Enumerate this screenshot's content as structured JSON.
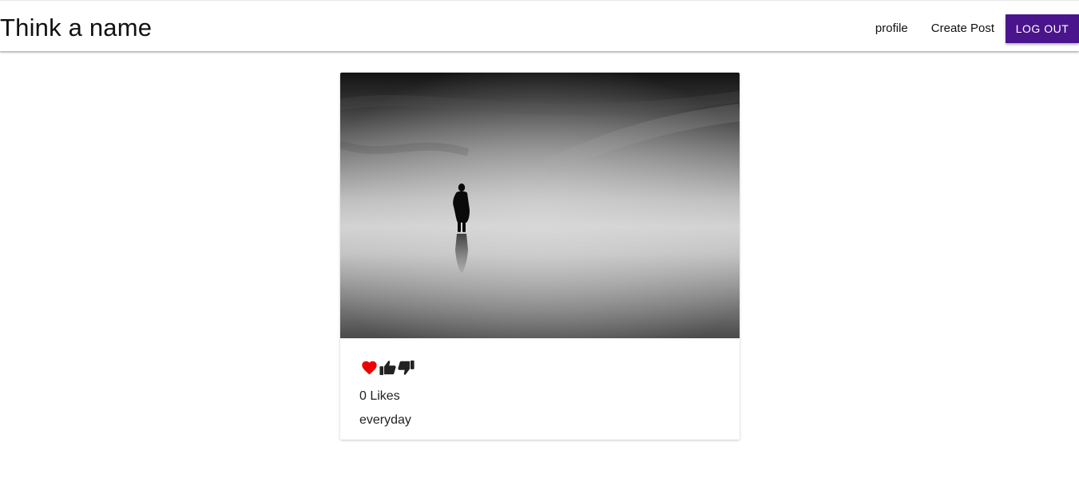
{
  "header": {
    "brand": "Think a name",
    "nav": {
      "profile": "profile",
      "create_post": "Create Post",
      "logout": "LOG OUT"
    },
    "accent_color": "#4a148c"
  },
  "post": {
    "image_icon": "photo-fog-silhouette",
    "actions": {
      "heart_icon": "heart-icon",
      "thumbs_up_icon": "thumbs-up-icon",
      "thumbs_down_icon": "thumbs-down-icon",
      "heart_color": "#ee0000"
    },
    "likes": "0 Likes",
    "caption": "everyday"
  }
}
